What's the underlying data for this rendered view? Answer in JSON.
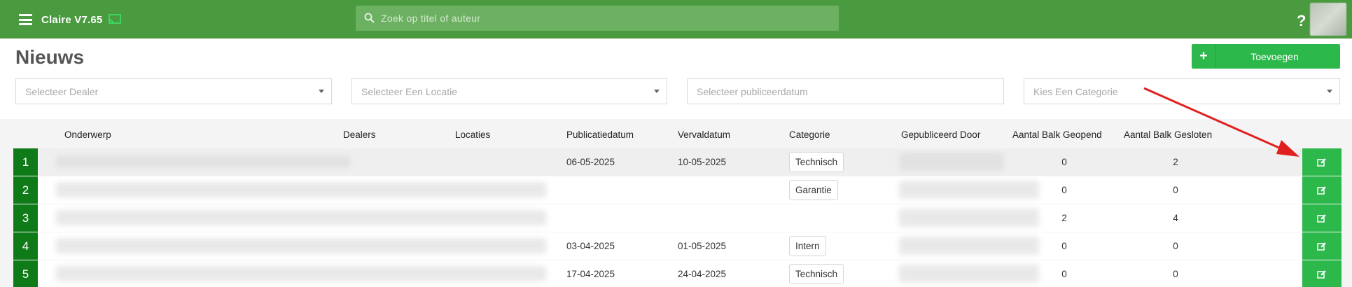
{
  "app": {
    "title": "Claire V7.65"
  },
  "search": {
    "placeholder": "Zoek op titel of auteur"
  },
  "page": {
    "title": "Nieuws"
  },
  "toolbar": {
    "add_label": "Toevoegen"
  },
  "filters": {
    "dealer": "Selecteer Dealer",
    "locatie": "Selecteer Een Locatie",
    "publicatiedatum": "Selecteer publiceerdatum",
    "categorie": "Kies Een Categorie"
  },
  "table": {
    "columns": [
      "Onderwerp",
      "Dealers",
      "Locaties",
      "Publicatiedatum",
      "Vervaldatum",
      "Categorie",
      "Gepubliceerd Door",
      "Aantal Balk Geopend",
      "Aantal Balk Gesloten"
    ],
    "rows": [
      {
        "num": "1",
        "publicatiedatum": "06-05-2025",
        "vervaldatum": "10-05-2025",
        "categorie": "Technisch",
        "geopend": "0",
        "gesloten": "2"
      },
      {
        "num": "2",
        "publicatiedatum": "",
        "vervaldatum": "",
        "categorie": "Garantie",
        "geopend": "0",
        "gesloten": "0"
      },
      {
        "num": "3",
        "publicatiedatum": "",
        "vervaldatum": "",
        "categorie": "",
        "geopend": "2",
        "gesloten": "4"
      },
      {
        "num": "4",
        "publicatiedatum": "03-04-2025",
        "vervaldatum": "01-05-2025",
        "categorie": "Intern",
        "geopend": "0",
        "gesloten": "0"
      },
      {
        "num": "5",
        "publicatiedatum": "17-04-2025",
        "vervaldatum": "24-04-2025",
        "categorie": "Technisch",
        "geopend": "0",
        "gesloten": "0"
      }
    ]
  },
  "colors": {
    "topbar": "#4a9a3f",
    "accent": "#2db84b",
    "row_number": "#0f7a18",
    "annotation_arrow": "#e0201e"
  },
  "icons": {
    "menu": "hamburger-icon",
    "cast": "cast-icon",
    "search": "search-icon",
    "help": "help-icon",
    "add": "plus-icon",
    "edit": "edit-icon"
  }
}
